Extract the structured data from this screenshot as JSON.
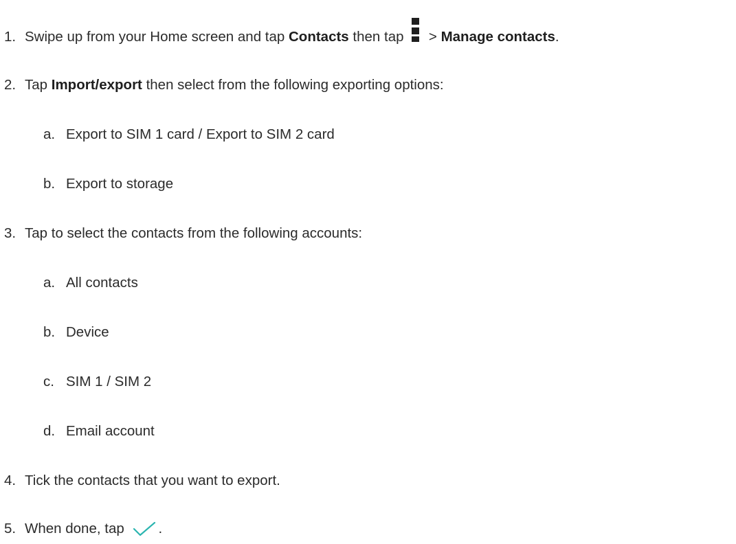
{
  "steps": {
    "s1": {
      "num": "1.",
      "pre": "Swipe up from your Home screen and tap ",
      "bold1": "Contacts",
      "mid": " then tap ",
      "icon": "more-menu-icon",
      "post": " > ",
      "bold2": "Manage contacts",
      "end": "."
    },
    "s2": {
      "num": "2.",
      "pre": "Tap ",
      "bold1": "Import/export",
      "post": " then select from the following exporting options:",
      "subs": [
        {
          "letter": "a.",
          "text": "Export to SIM 1 card / Export to SIM 2 card"
        },
        {
          "letter": "b.",
          "text": "Export to storage"
        }
      ]
    },
    "s3": {
      "num": "3.",
      "text": "Tap to select the contacts from the following accounts:",
      "subs": [
        {
          "letter": "a.",
          "text": "All contacts"
        },
        {
          "letter": "b.",
          "text": "Device"
        },
        {
          "letter": "c.",
          "text": "SIM 1 / SIM 2"
        },
        {
          "letter": "d.",
          "text": "Email account"
        }
      ]
    },
    "s4": {
      "num": "4.",
      "text": "Tick the contacts that you want to export."
    },
    "s5": {
      "num": "5.",
      "pre": "When done, tap ",
      "icon": "checkmark-icon",
      "end": "."
    }
  },
  "colors": {
    "text": "#2b2b2b",
    "check": "#2bb5b0"
  }
}
